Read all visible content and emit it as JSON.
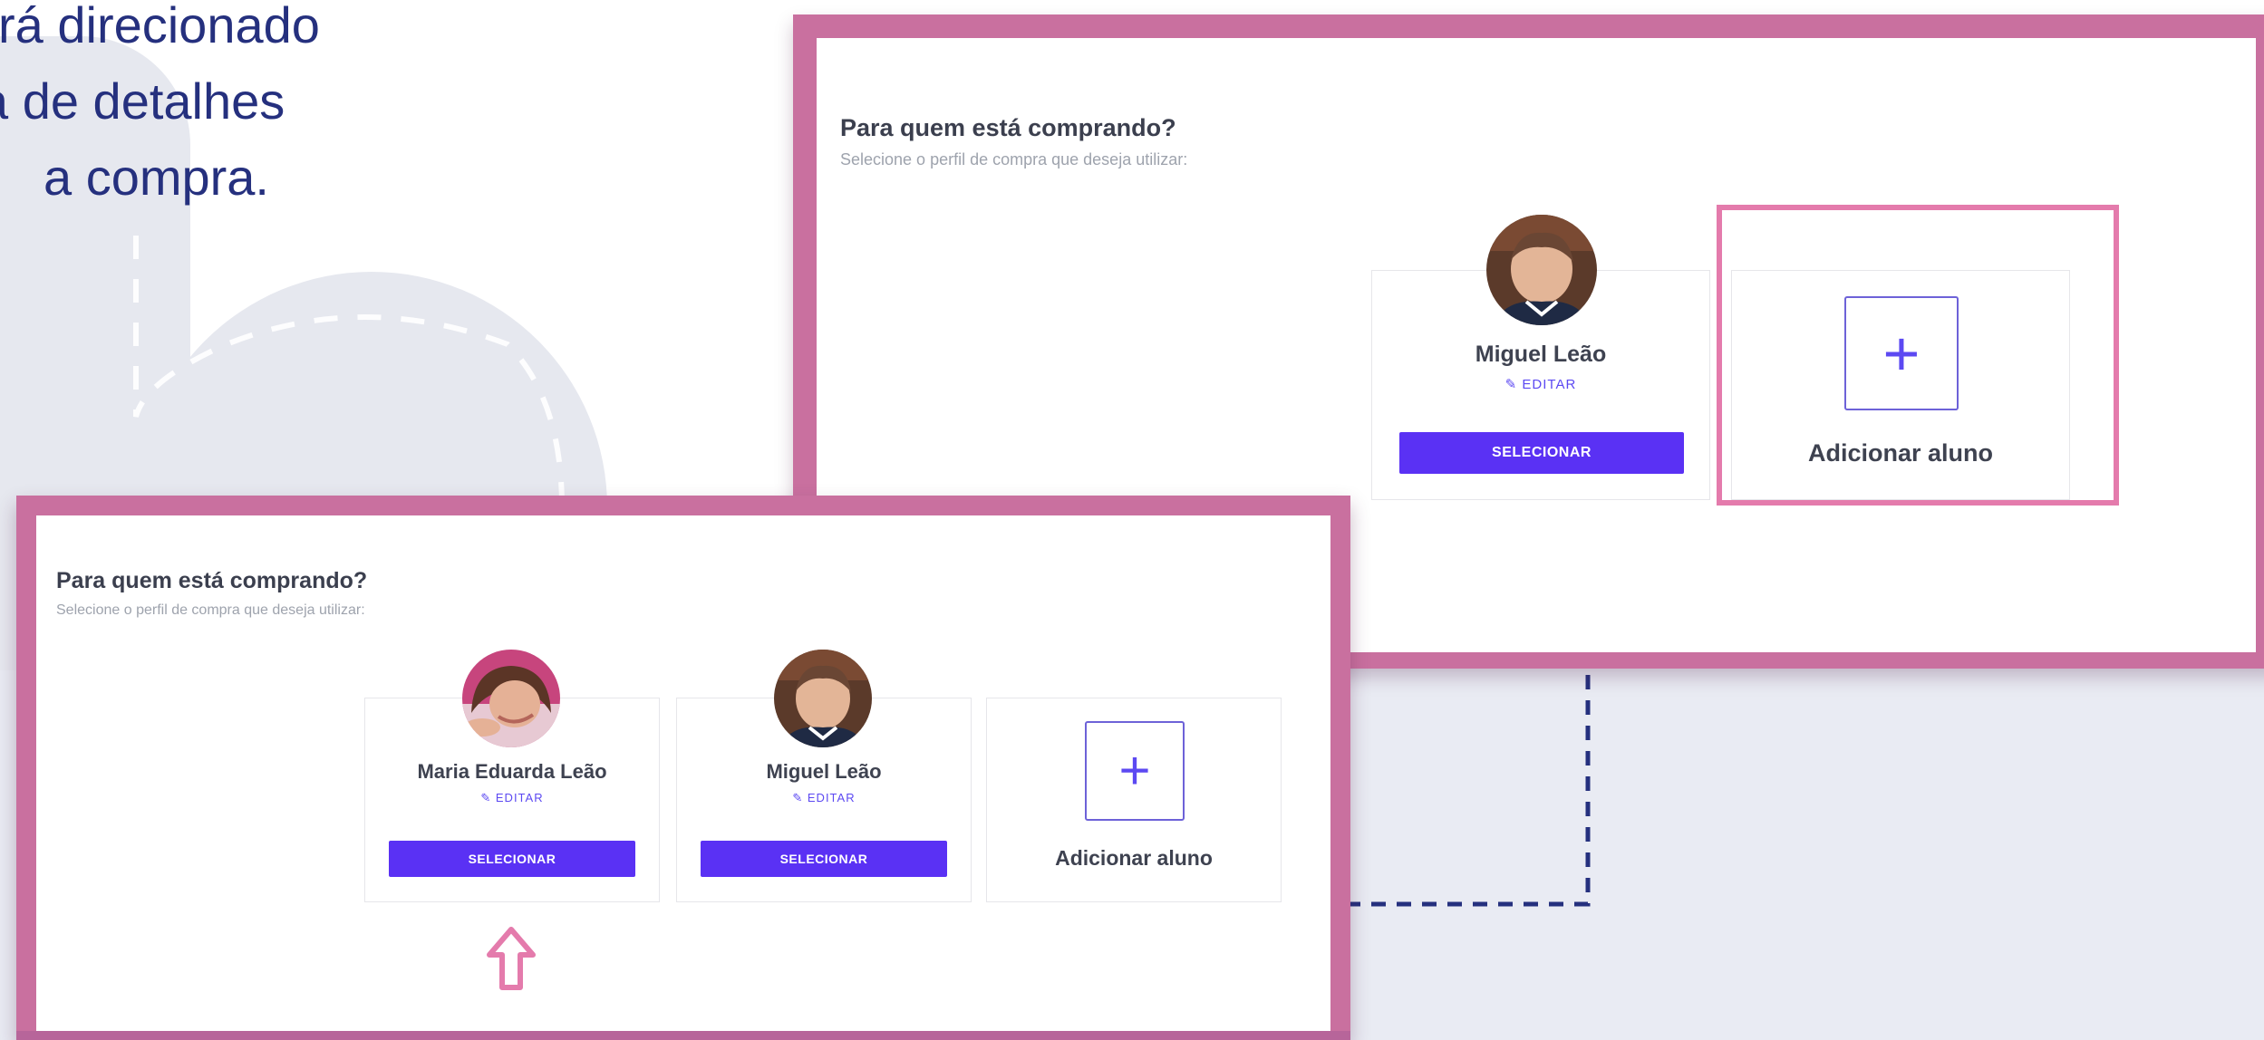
{
  "caption": {
    "lines": [
      "rá direcionado",
      "a de detalhes",
      "a compra."
    ]
  },
  "panel_top": {
    "title": "Para quem está comprando?",
    "subtitle": "Selecione o perfil de compra que deseja utilizar:",
    "profiles": [
      {
        "name": "Miguel Leão",
        "edit_label": "EDITAR",
        "select_label": "SELECIONAR"
      }
    ],
    "add_student": {
      "label": "Adicionar aluno",
      "plus": "+"
    }
  },
  "panel_bottom": {
    "title": "Para quem está comprando?",
    "subtitle": "Selecione o perfil de compra que deseja utilizar:",
    "profiles": [
      {
        "name": "Maria Eduarda Leão",
        "edit_label": "EDITAR",
        "select_label": "SELECIONAR"
      },
      {
        "name": "Miguel Leão",
        "edit_label": "EDITAR",
        "select_label": "SELECIONAR"
      }
    ],
    "add_student": {
      "label": "Adicionar aluno",
      "plus": "+"
    }
  },
  "icons": {
    "edit": "edit-icon",
    "arrow": "up-arrow-icon",
    "plus": "plus-icon"
  },
  "colors": {
    "frame": "#c9709f",
    "highlight": "#e47bac",
    "primary_button": "#5a31f4",
    "accent_text": "#5c49f2",
    "caption_text": "#25307e",
    "dash": "#25307e"
  }
}
